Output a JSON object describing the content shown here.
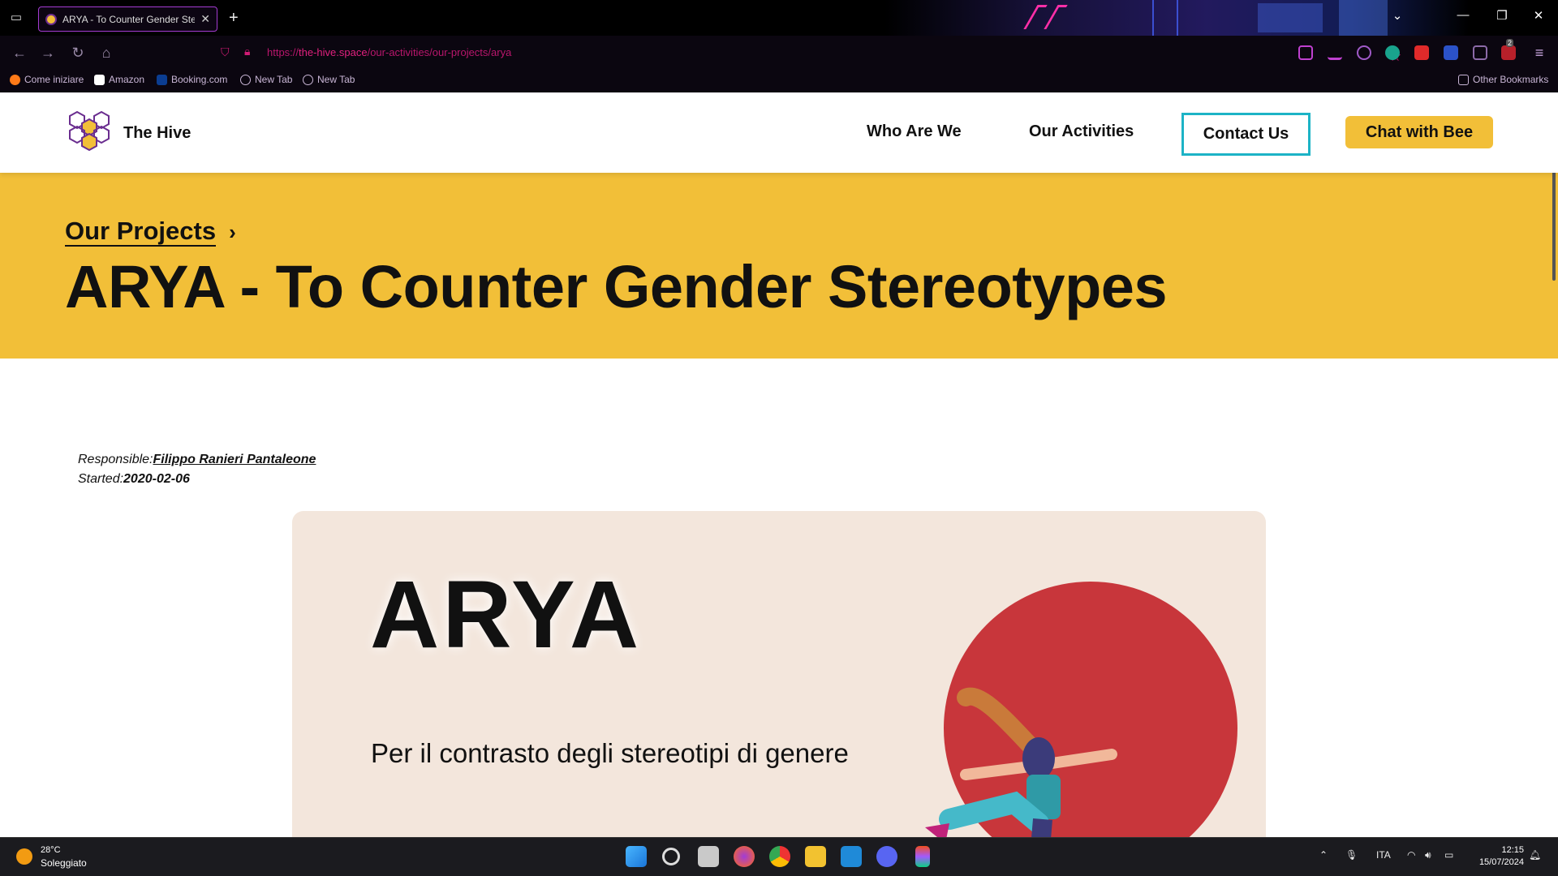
{
  "browser": {
    "tab_title": "ARYA - To Counter Gender Stereotypes",
    "url_domain": "the-hive.space",
    "url_prefix": "https://",
    "url_path": "/our-activities/our-projects/arya",
    "bookmarks": [
      "Come iniziare",
      "Amazon",
      "Booking.com",
      "New Tab",
      "New Tab"
    ],
    "other_bookmarks": "Other Bookmarks",
    "extension_badge": "2"
  },
  "site": {
    "brand_name": "The Hive",
    "nav": {
      "who": "Who Are We",
      "activities": "Our Activities",
      "contact": "Contact Us",
      "chat": "Chat with Bee"
    },
    "hero": {
      "breadcrumb": "Our Projects",
      "title": "ARYA - To Counter Gender Stereotypes"
    },
    "meta": {
      "responsible_label": "Responsible:",
      "responsible_value": "Filippo Ranieri Pantaleone",
      "started_label": "Started:",
      "started_value": "2020-02-06"
    },
    "project_image": {
      "title": "ARYA",
      "subtitle": "Per il contrasto degli stereotipi di genere"
    },
    "colors": {
      "accent": "#f2bf38",
      "contact_border": "#1cb3c6",
      "circle": "#c8363b"
    }
  },
  "taskbar": {
    "temperature": "28°C",
    "weather": "Soleggiato",
    "language": "ITA",
    "time": "12:15",
    "date": "15/07/2024"
  }
}
